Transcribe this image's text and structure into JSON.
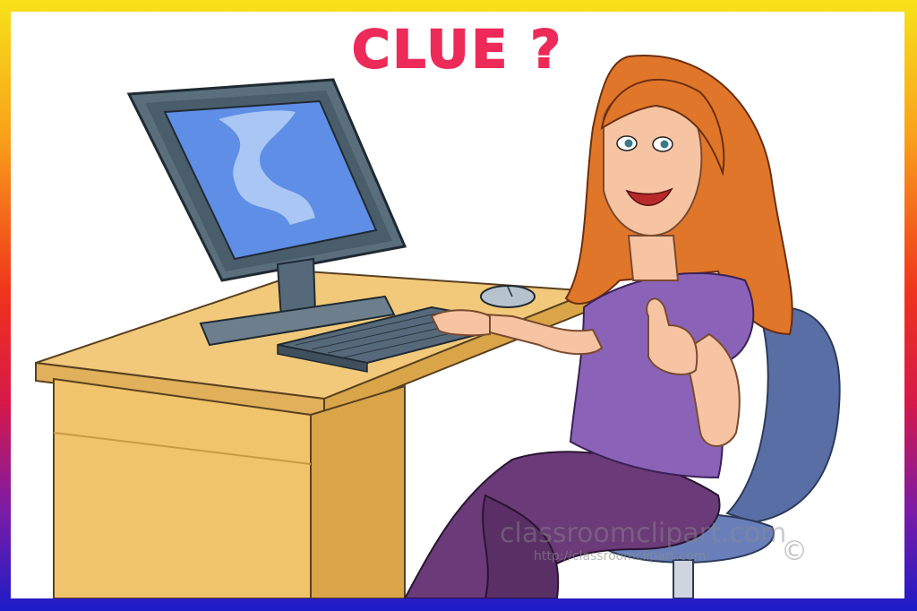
{
  "title": "CLUE ?",
  "watermark": {
    "brand": "classroomclipart.com",
    "url": "http://classroomclipart.com",
    "copyright": "©"
  },
  "colors": {
    "title": "#ee2a58",
    "desk": "#f0c46a",
    "desk_dark": "#d9a548",
    "monitor": "#5a6e7c",
    "screen": "#5f8ee6",
    "hair": "#e0762a",
    "shirt": "#8a63b8",
    "pants": "#6b3a78",
    "chair": "#5a6ea6",
    "skin": "#f6c4a2"
  }
}
